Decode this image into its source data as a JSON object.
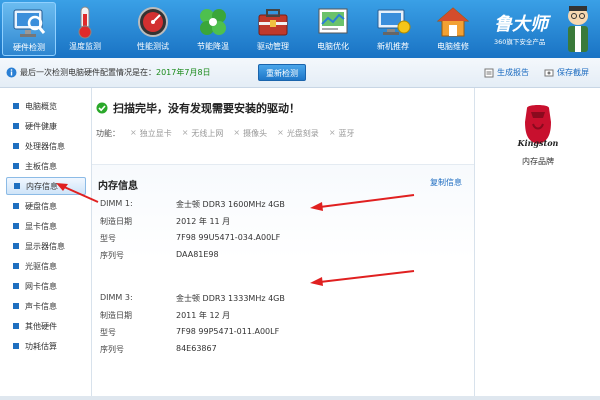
{
  "toolbar": {
    "items": [
      {
        "label": "硬件检测",
        "icon": "monitor-magnifier-icon"
      },
      {
        "label": "温度监测",
        "icon": "thermometer-icon"
      },
      {
        "label": "性能测试",
        "icon": "speedometer-icon"
      },
      {
        "label": "节能降温",
        "icon": "leaf-fan-icon"
      },
      {
        "label": "驱动管理",
        "icon": "toolbox-icon"
      },
      {
        "label": "电脑优化",
        "icon": "image-chart-icon"
      },
      {
        "label": "新机推荐",
        "icon": "computer-badge-icon"
      },
      {
        "label": "电脑维修",
        "icon": "house-repair-icon"
      }
    ],
    "active_index": 0,
    "brand_name": "鲁大师",
    "brand_sub": "360旗下安全产品"
  },
  "status": {
    "text": "最后一次检测电脑硬件配置情况是在：",
    "date": "2017年7月8日",
    "rescan_label": "重新检测",
    "report_label": "生成报告",
    "screenshot_label": "保存截屏"
  },
  "sidebar": {
    "items": [
      {
        "label": "电脑概览"
      },
      {
        "label": "硬件健康"
      },
      {
        "label": "处理器信息"
      },
      {
        "label": "主板信息"
      },
      {
        "label": "内存信息"
      },
      {
        "label": "硬盘信息"
      },
      {
        "label": "显卡信息"
      },
      {
        "label": "显示器信息"
      },
      {
        "label": "光驱信息"
      },
      {
        "label": "网卡信息"
      },
      {
        "label": "声卡信息"
      },
      {
        "label": "其他硬件"
      },
      {
        "label": "功耗估算"
      }
    ],
    "active_index": 4
  },
  "main": {
    "scan_result": "扫描完毕，没有发现需要安装的驱动！",
    "func_label": "功能：",
    "func_items": [
      "独立显卡",
      "无线上网",
      "摄像头",
      "光盘刻录",
      "蓝牙"
    ],
    "mem_title": "内存信息",
    "copy_label": "复制信息",
    "dimm1": {
      "slot_label": "DIMM 1:",
      "slot_value": "金士顿 DDR3 1600MHz 4GB",
      "date_label": "制造日期",
      "date_value": "2012 年 11 月",
      "model_label": "型号",
      "model_value": "7F98 99U5471-034.A00LF",
      "serial_label": "序列号",
      "serial_value": "DAA81E98"
    },
    "dimm3": {
      "slot_label": "DIMM 3:",
      "slot_value": "金士顿 DDR3 1333MHz 4GB",
      "date_label": "制造日期",
      "date_value": "2011 年 12 月",
      "model_label": "型号",
      "model_value": "7F98 99P5471-011.A00LF",
      "serial_label": "序列号",
      "serial_value": "84E63867"
    }
  },
  "right": {
    "logo_text": "Kingston",
    "caption": "内存品牌"
  },
  "colors": {
    "toolbar_top": "#3aa0e6",
    "toolbar_bottom": "#1a73c4",
    "accent": "#1e6fc0",
    "arrow": "#e02020",
    "date_green": "#1a8a1a",
    "link_blue": "#1a6ac0"
  }
}
